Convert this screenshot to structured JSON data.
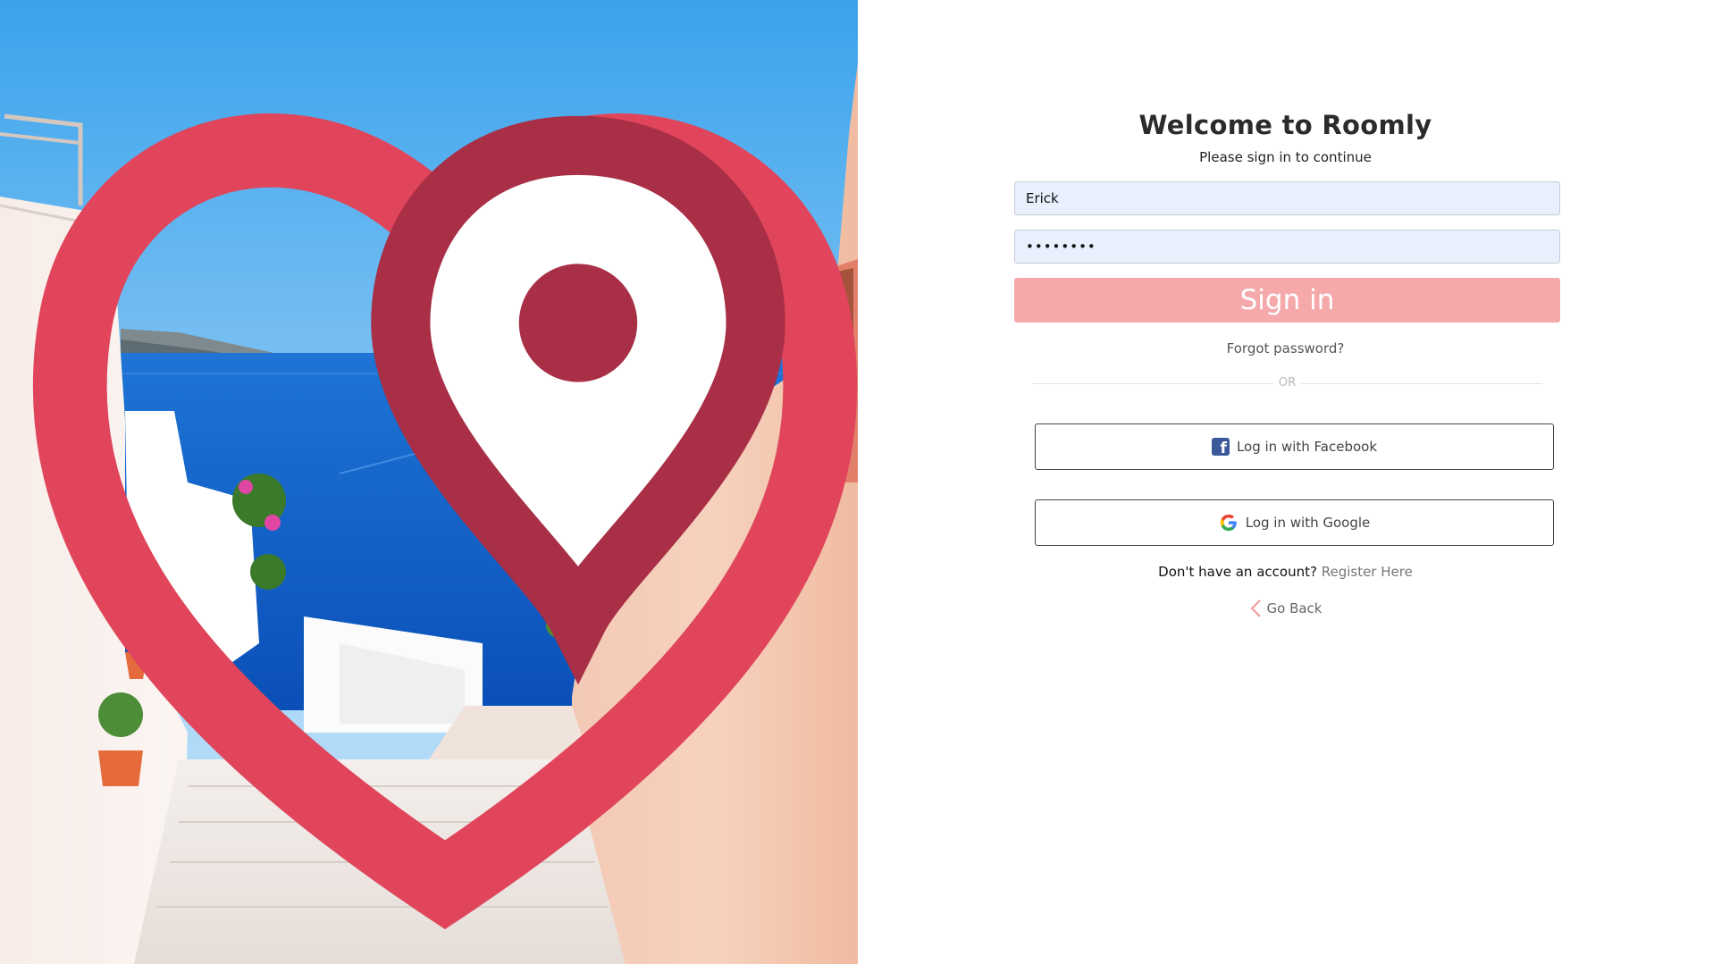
{
  "brand": {
    "accent_color": "#f5a9ab",
    "logo_icon": "heart-pin-logo-icon"
  },
  "form": {
    "title": "Welcome to Roomly",
    "subtitle": "Please sign in to continue",
    "username_value": "Erick",
    "password_value": "••••••••",
    "signin_label": "Sign in",
    "forgot_label": "Forgot password?",
    "or_label": "OR",
    "facebook_label": "Log in with Facebook",
    "google_label": "Log in with Google",
    "register_prompt": "Don't have an account?",
    "register_link": "Register Here",
    "back_label": "Go Back"
  },
  "icons": {
    "facebook": "facebook-icon",
    "google": "google-icon",
    "back": "chevron-left-icon"
  }
}
